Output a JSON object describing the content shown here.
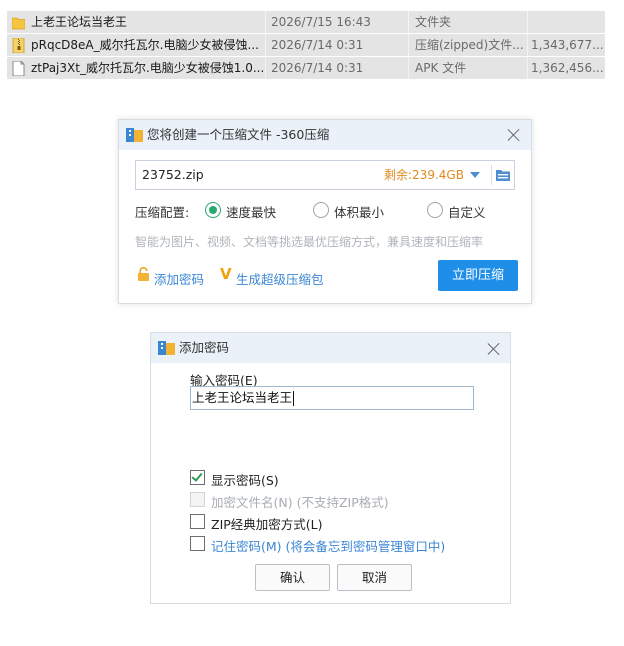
{
  "file_list": {
    "rows": [
      {
        "icon": "folder-icon",
        "name": "上老王论坛当老王",
        "date": "2026/7/15 16:43",
        "type": "文件夹",
        "size": ""
      },
      {
        "icon": "zip-file-icon",
        "name": "pRqcD8eA_威尔托瓦尔.电脑少女被侵蚀...",
        "date": "2026/7/14 0:31",
        "type": "压缩(zipped)文件...",
        "size": "1,343,677..."
      },
      {
        "icon": "file-icon",
        "name": "ztPaj3Xt_威尔托瓦尔.电脑少女被侵蚀1.0...",
        "date": "2026/7/14 0:31",
        "type": "APK 文件",
        "size": "1,362,456..."
      }
    ]
  },
  "compress_dialog": {
    "title": "您将创建一个压缩文件 -360压缩",
    "filename": "23752.zip",
    "free_space": "剩余:239.4GB",
    "config_label": "压缩配置:",
    "options": [
      "速度最快",
      "体积最小",
      "自定义"
    ],
    "selected_option": "速度最快",
    "hint": "智能为图片、视频、文档等挑选最优压缩方式，兼具速度和压缩率",
    "add_password": "添加密码",
    "super_package": "生成超级压缩包",
    "compress_button": "立即压缩",
    "accent_color": "#1e8ee8"
  },
  "password_dialog": {
    "title": "添加密码",
    "input_label": "输入密码(E)",
    "password_value": "上老王论坛当老王",
    "checkboxes": [
      {
        "label": "显示密码(S)",
        "checked": true,
        "disabled": false
      },
      {
        "label": "加密文件名(N) (不支持ZIP格式)",
        "checked": false,
        "disabled": true
      },
      {
        "label": "ZIP经典加密方式(L)",
        "checked": false,
        "disabled": false
      },
      {
        "label": "记住密码(M) (将会备忘到密码管理窗口中)",
        "checked": false,
        "disabled": false
      }
    ],
    "ok_button": "确认",
    "cancel_button": "取消"
  }
}
